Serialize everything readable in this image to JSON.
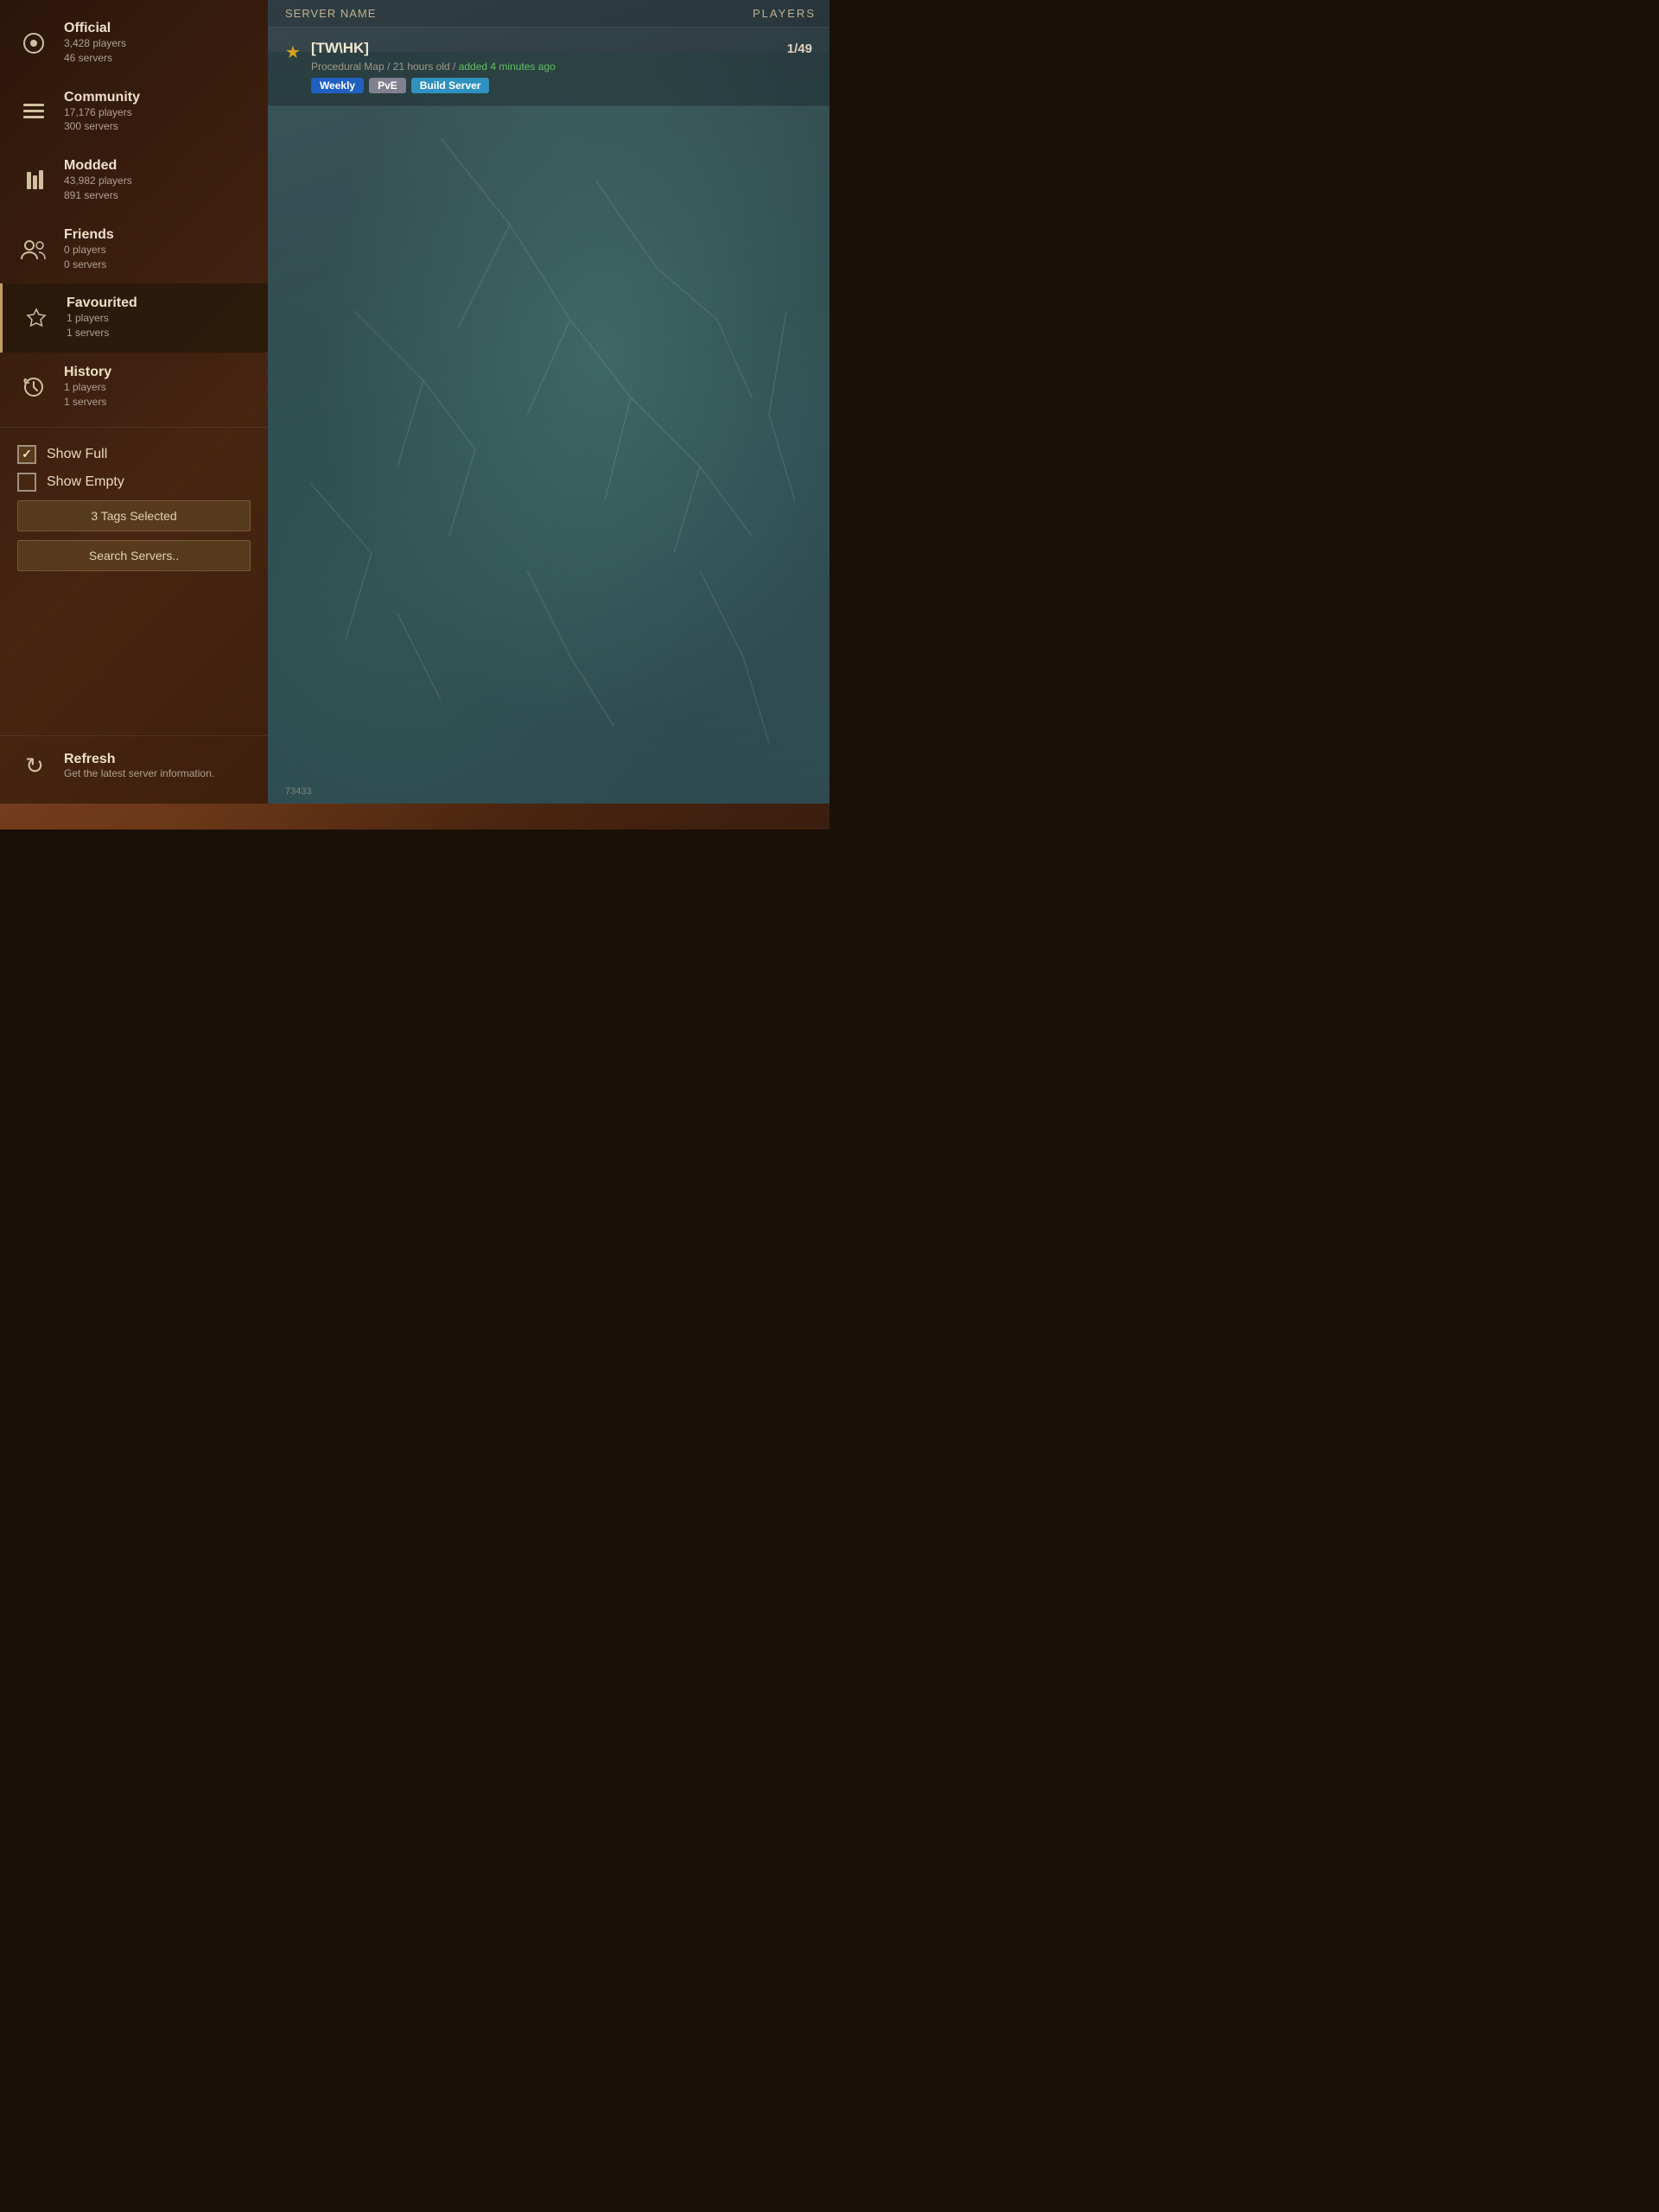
{
  "sidebar": {
    "nav_items": [
      {
        "id": "official",
        "icon": "⊕",
        "title": "Official",
        "line1": "3,428 players",
        "line2": "46 servers",
        "active": false
      },
      {
        "id": "community",
        "icon": "☰",
        "title": "Community",
        "line1": "17,176 players",
        "line2": "300 servers",
        "active": false
      },
      {
        "id": "modded",
        "icon": "⚙",
        "title": "Modded",
        "line1": "43,982 players",
        "line2": "891 servers",
        "active": false
      },
      {
        "id": "friends",
        "icon": "👥",
        "title": "Friends",
        "line1": "0 players",
        "line2": "0 servers",
        "active": false
      },
      {
        "id": "favourited",
        "icon": "☆",
        "title": "Favourited",
        "line1": "1 players",
        "line2": "1 servers",
        "active": true
      },
      {
        "id": "history",
        "icon": "🕐",
        "title": "History",
        "line1": "1 players",
        "line2": "1 servers",
        "active": false
      }
    ],
    "filters": {
      "show_full": {
        "label": "Show Full",
        "checked": true
      },
      "show_empty": {
        "label": "Show Empty",
        "checked": false
      },
      "tags_button": "3 Tags Selected",
      "search_button": "Search Servers.."
    },
    "refresh": {
      "title": "Refresh",
      "subtitle": "Get the latest server information."
    }
  },
  "main": {
    "header": {
      "col_server_name": "SERVER NAME",
      "col_players": "PLAYERS"
    },
    "servers": [
      {
        "id": 1,
        "name": "[TW\\HK]",
        "starred": true,
        "meta": "Procedural Map / 21 hours old / ",
        "added_text": "added 4 minutes ago",
        "tags": [
          "Weekly",
          "PvE",
          "Build Server"
        ],
        "tag_classes": [
          "tag-weekly",
          "tag-pve",
          "tag-build"
        ],
        "players": "1/49"
      }
    ],
    "map_id": "73433",
    "players_label": "PLAYERS"
  }
}
